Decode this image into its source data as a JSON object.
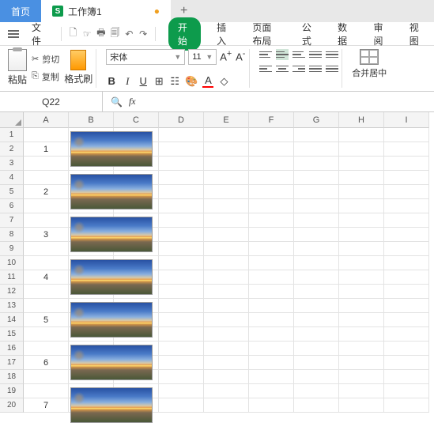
{
  "tabs": {
    "home": "首页",
    "workbook": "工作簿1"
  },
  "menu": {
    "file": "文件"
  },
  "menutabs": {
    "start": "开始",
    "insert": "插入",
    "layout": "页面布局",
    "formula": "公式",
    "data": "数据",
    "review": "审阅",
    "view": "视图"
  },
  "ribbon": {
    "paste": "粘贴",
    "cut": "剪切",
    "copy": "复制",
    "format": "格式刷",
    "font": "宋体",
    "size": "11",
    "merge": "合并居中"
  },
  "cellref": "Q22",
  "cols": [
    "A",
    "B",
    "C",
    "D",
    "E",
    "F",
    "G",
    "H",
    "I"
  ],
  "rows": [
    "1",
    "2",
    "3",
    "4",
    "5",
    "6",
    "7",
    "8",
    "9",
    "10",
    "11",
    "12",
    "13",
    "14",
    "15",
    "16",
    "17",
    "18",
    "19",
    "20"
  ],
  "values": {
    "r2": "1",
    "r5": "2",
    "r8": "3",
    "r11": "4",
    "r14": "5",
    "r17": "6",
    "r20": "7"
  }
}
